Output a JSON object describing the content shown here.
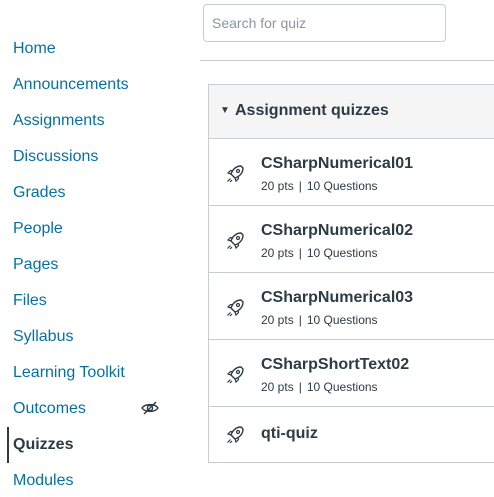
{
  "nav": {
    "items": [
      {
        "label": "Home"
      },
      {
        "label": "Announcements"
      },
      {
        "label": "Assignments"
      },
      {
        "label": "Discussions"
      },
      {
        "label": "Grades"
      },
      {
        "label": "People"
      },
      {
        "label": "Pages"
      },
      {
        "label": "Files"
      },
      {
        "label": "Syllabus"
      },
      {
        "label": "Learning Toolkit"
      },
      {
        "label": "Outcomes",
        "hidden_icon": "eye-off-icon"
      },
      {
        "label": "Quizzes",
        "active": true
      },
      {
        "label": "Modules"
      }
    ]
  },
  "search": {
    "placeholder": "Search for quiz",
    "value": ""
  },
  "group": {
    "title": "Assignment quizzes",
    "expanded": true,
    "quizzes": [
      {
        "title": "CSharpNumerical01",
        "points": "20 pts",
        "questions": "10 Questions"
      },
      {
        "title": "CSharpNumerical02",
        "points": "20 pts",
        "questions": "10 Questions"
      },
      {
        "title": "CSharpNumerical03",
        "points": "20 pts",
        "questions": "10 Questions"
      },
      {
        "title": "CSharpShortText02",
        "points": "20 pts",
        "questions": "10 Questions"
      },
      {
        "title": "qti-quiz"
      }
    ]
  },
  "meta_separator": "|",
  "colors": {
    "link": "#0770a3",
    "text": "#2d3b45",
    "border": "#c7cdd1",
    "header_bg": "#f5f5f5"
  }
}
